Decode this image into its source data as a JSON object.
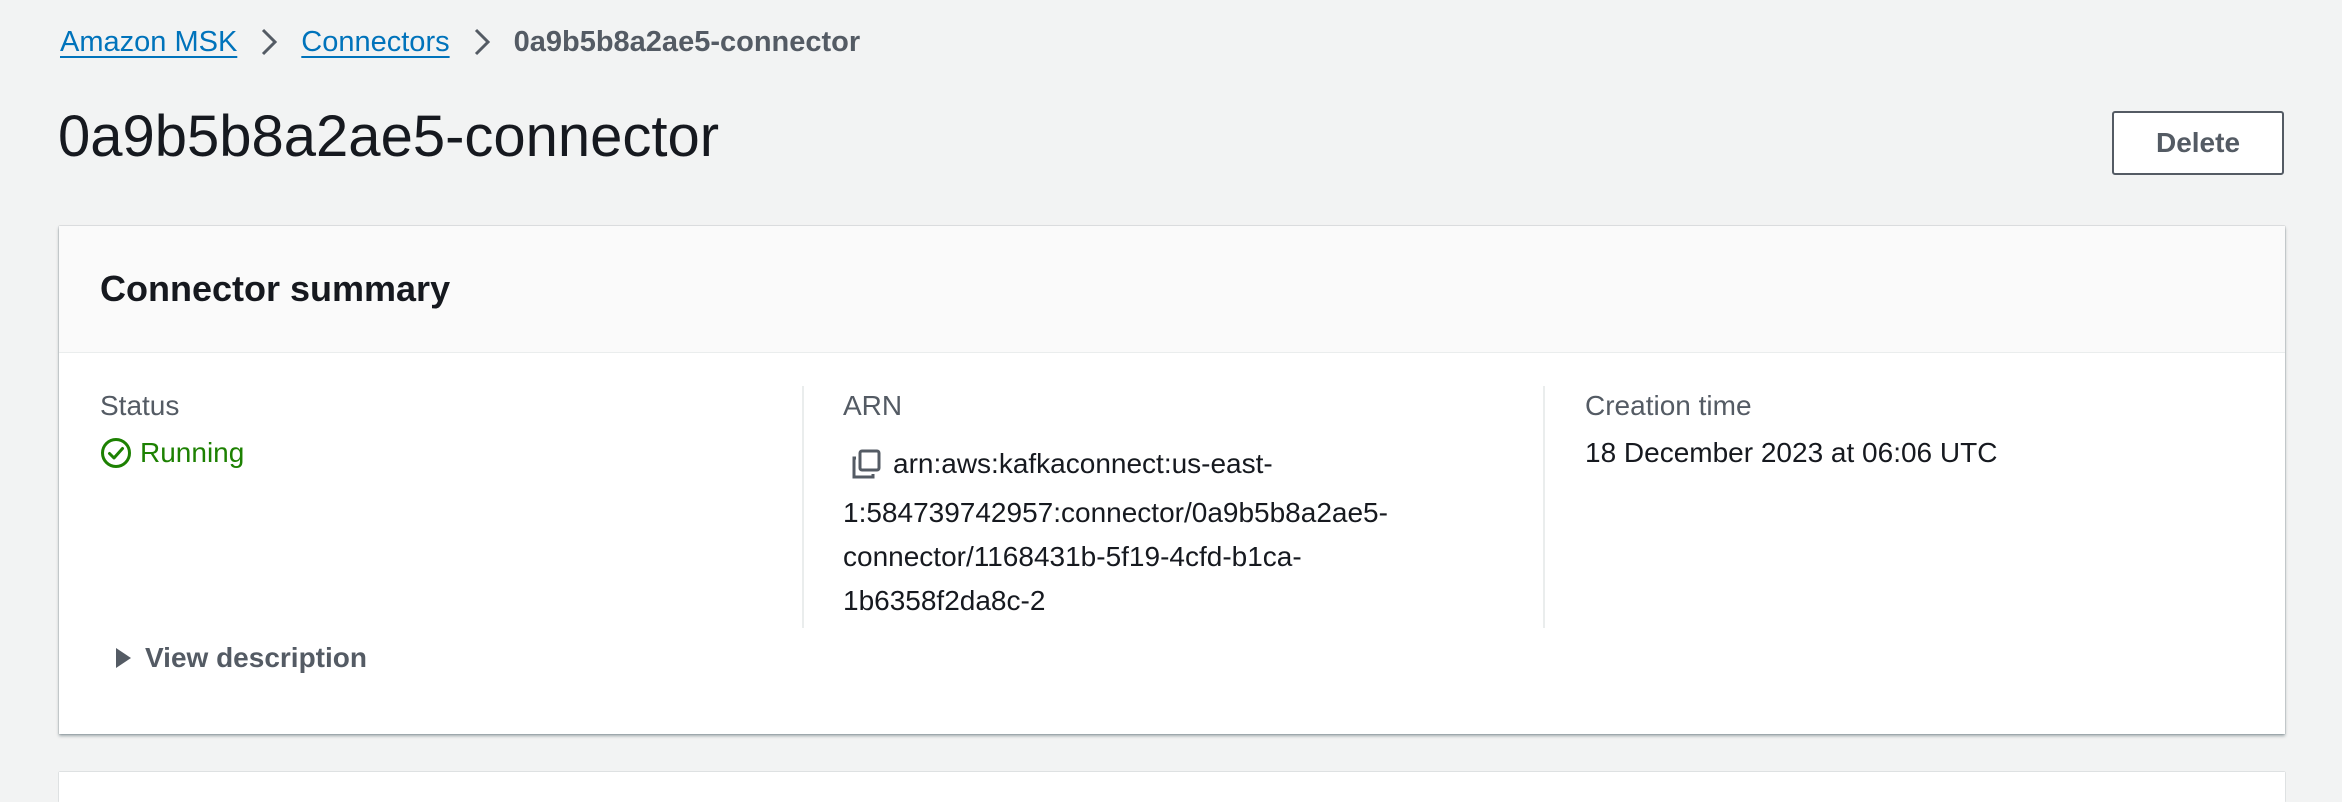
{
  "breadcrumb": {
    "items": [
      {
        "label": "Amazon MSK"
      },
      {
        "label": "Connectors"
      }
    ],
    "current": "0a9b5b8a2ae5-connector"
  },
  "header": {
    "title": "0a9b5b8a2ae5-connector",
    "delete_label": "Delete"
  },
  "summary": {
    "title": "Connector summary",
    "status": {
      "label": "Status",
      "value": "Running",
      "icon": "check-circle-icon",
      "color": "#1d8102"
    },
    "arn": {
      "label": "ARN",
      "icon": "copy-icon",
      "lines": [
        "arn:aws:kafkaconnect:us-east-",
        "1:584739742957:connector/0a9b5b8a2ae5-",
        "connector/1168431b-5f19-4cfd-b1ca-",
        "1b6358f2da8c-2"
      ]
    },
    "creation_time": {
      "label": "Creation time",
      "value": "18 December 2023 at 06:06 UTC"
    },
    "view_description_label": "View description"
  },
  "colors": {
    "link": "#0073bb",
    "background": "#f2f3f3",
    "success": "#1d8102",
    "secondary_text": "#545b64"
  }
}
